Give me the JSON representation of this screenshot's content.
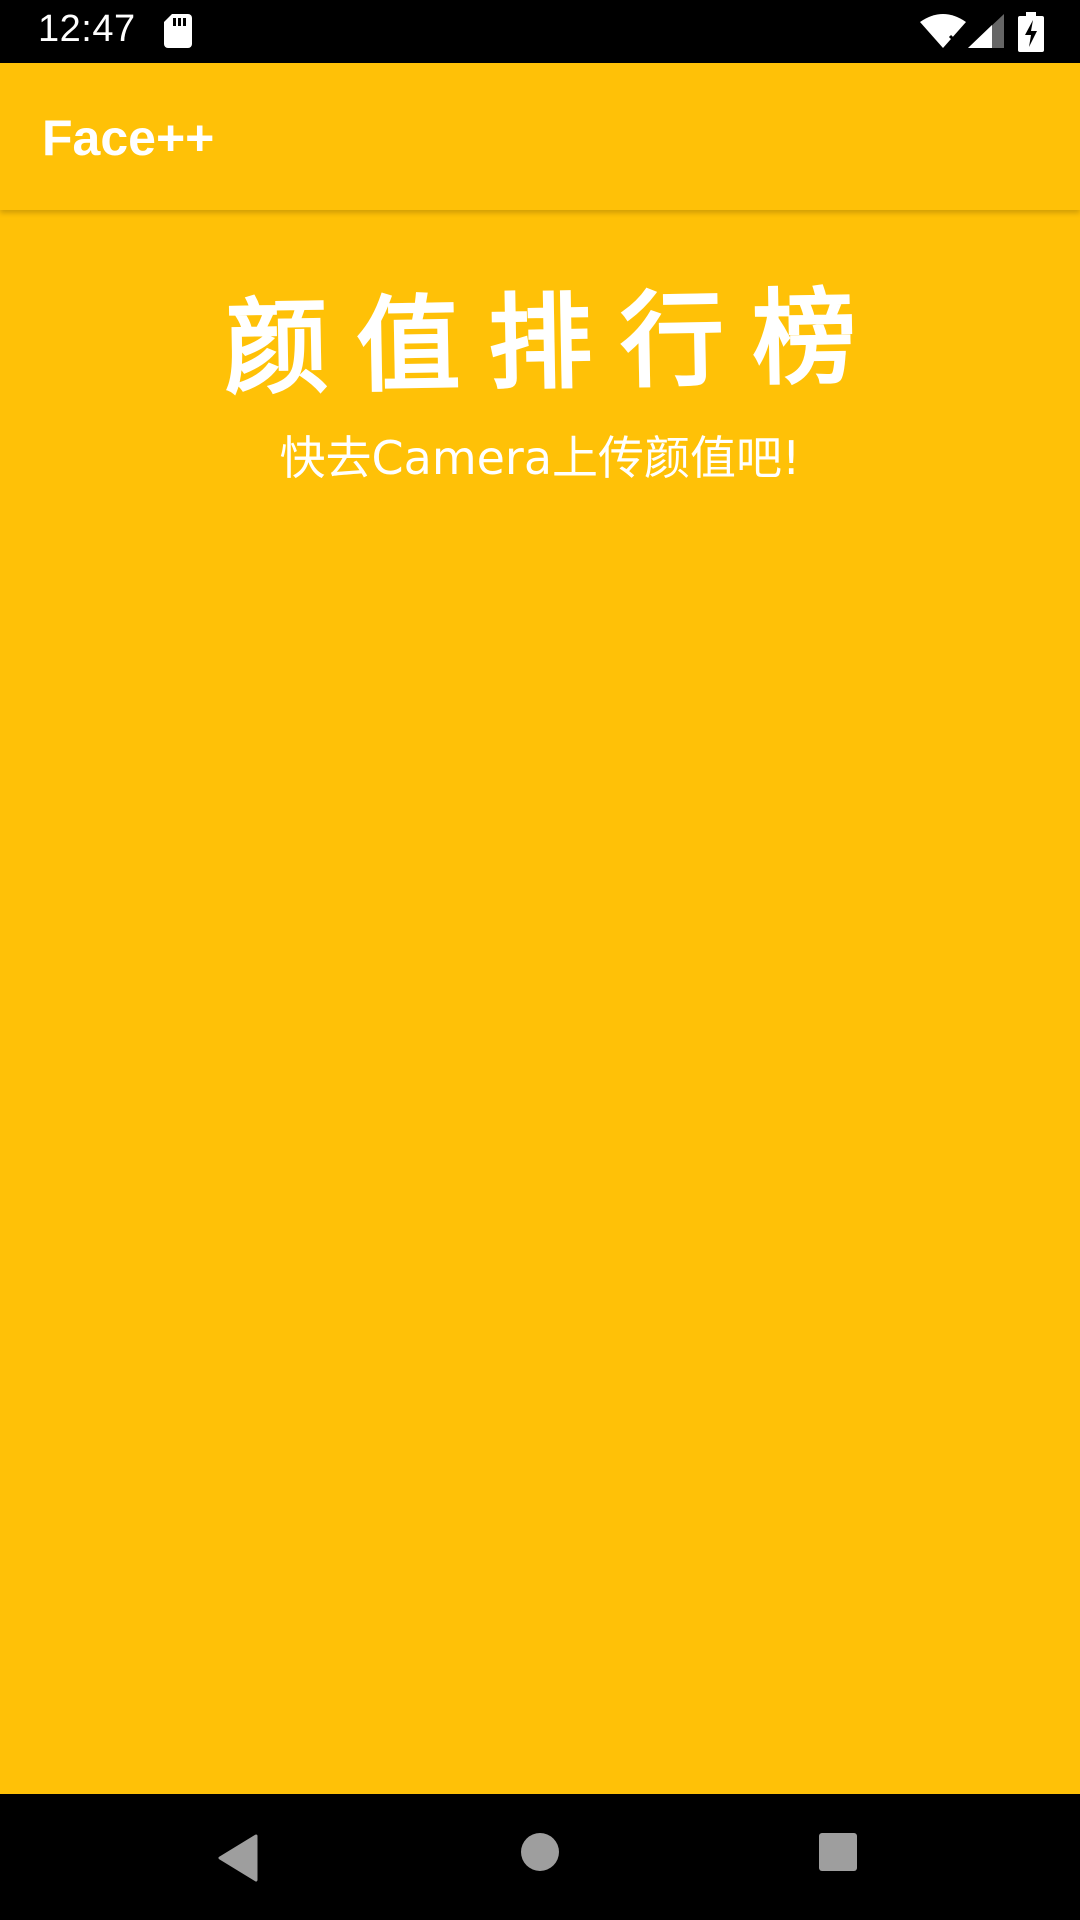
{
  "status_bar": {
    "time": "12:47",
    "icons": [
      "sd-card-icon",
      "wifi-icon",
      "signal-icon",
      "battery-charging-icon"
    ]
  },
  "app_bar": {
    "title": "Face++"
  },
  "main": {
    "ranking_title": "颜值排行榜",
    "empty_message": "快去Camera上传颜值吧!"
  },
  "nav_bar": {
    "icons": [
      "back-icon",
      "home-icon",
      "recents-icon"
    ]
  },
  "colors": {
    "primary": "#FFC107",
    "text": "#FFFFFF",
    "system_bars": "#000000"
  }
}
